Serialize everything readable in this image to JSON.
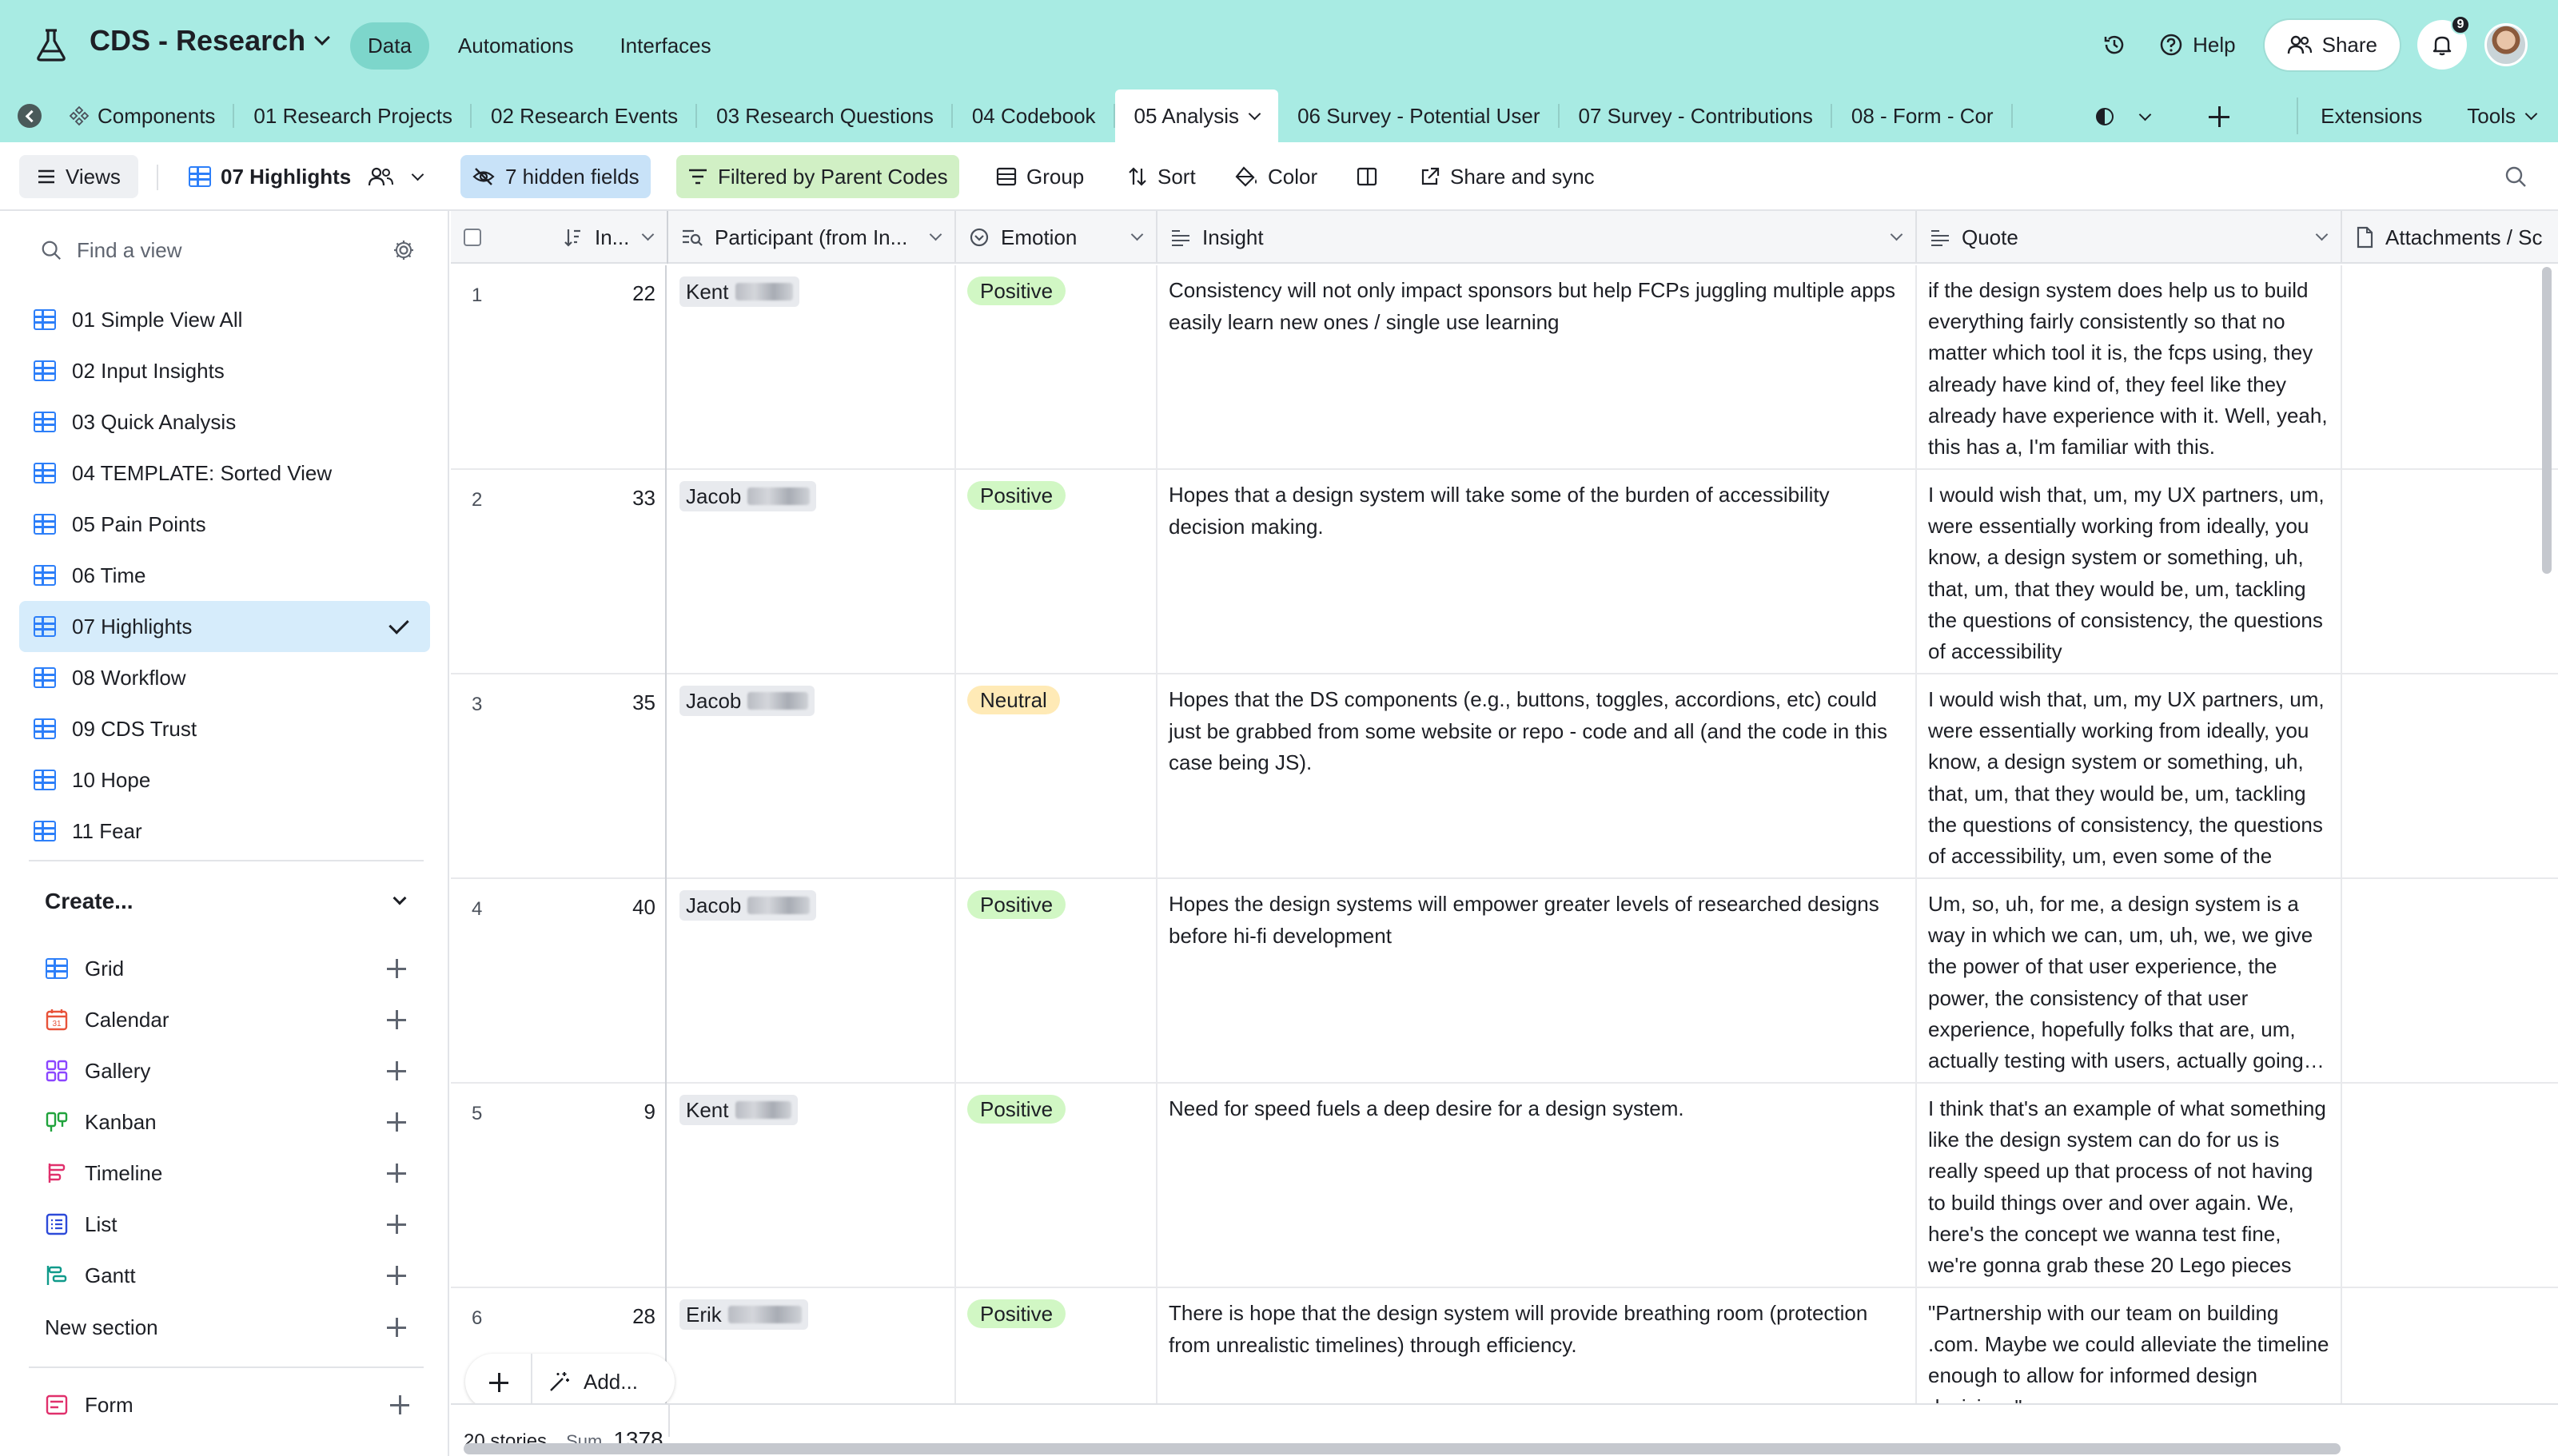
{
  "app": {
    "base_title": "CDS - Research",
    "nav": [
      "Data",
      "Automations",
      "Interfaces"
    ],
    "help_label": "Help",
    "share_label": "Share",
    "notification_count": "9",
    "accent_color": "#a8ebe3"
  },
  "tables": {
    "tabs": [
      "Components",
      "01 Research Projects",
      "02 Research Events",
      "03 Research Questions",
      "04 Codebook",
      "05 Analysis",
      "06 Survey - Potential User",
      "07 Survey - Contributions",
      "08 - Form - Cor"
    ],
    "active_tab": "05 Analysis",
    "extensions_label": "Extensions",
    "tools_label": "Tools"
  },
  "toolbar": {
    "views_label": "Views",
    "view_name": "07 Highlights",
    "hidden_fields": "7 hidden fields",
    "filter": "Filtered by Parent Codes",
    "group": "Group",
    "sort": "Sort",
    "color": "Color",
    "share_sync": "Share and sync"
  },
  "sidebar": {
    "find_placeholder": "Find a view",
    "views": [
      "01 Simple View All",
      "02 Input Insights",
      "03 Quick Analysis",
      "04 TEMPLATE: Sorted View",
      "05 Pain Points",
      "06 Time",
      "07 Highlights",
      "08 Workflow",
      "09 CDS Trust",
      "10 Hope",
      "11 Fear"
    ],
    "active_view": "07 Highlights",
    "create_label": "Create...",
    "create_items": [
      {
        "label": "Grid",
        "icon": "grid-icon"
      },
      {
        "label": "Calendar",
        "icon": "calendar-icon"
      },
      {
        "label": "Gallery",
        "icon": "gallery-icon"
      },
      {
        "label": "Kanban",
        "icon": "kanban-icon"
      },
      {
        "label": "Timeline",
        "icon": "timeline-icon"
      },
      {
        "label": "List",
        "icon": "list-icon"
      },
      {
        "label": "Gantt",
        "icon": "gantt-icon"
      }
    ],
    "new_section": "New section",
    "form_label": "Form"
  },
  "grid": {
    "columns": {
      "in": "In...",
      "participant": "Participant (from In...",
      "emotion": "Emotion",
      "insight": "Insight",
      "quote": "Quote",
      "attachments": "Attachments / Sc"
    },
    "rows": [
      {
        "n": "1",
        "in": "22",
        "participant": "Kent",
        "emotion": "Positive",
        "insight": "Consistency will not only impact sponsors but help FCPs juggling multiple apps easily learn new ones / single use learning",
        "quote": "if the design system does help us to build everything fairly consistently so that no matter which tool it is, the fcps using, they already have kind of, they feel like they already have experience with it. Well, yeah, this has a, I'm familiar with this."
      },
      {
        "n": "2",
        "in": "33",
        "participant": "Jacob",
        "emotion": "Positive",
        "insight": "Hopes that a design system will take some of the burden of accessibility decision making.",
        "quote": "I would wish that, um, my UX partners, um, were essentially working from ideally, you know, a design system or something, uh, that, um, that they would be, um, tackling the questions of consistency, the questions of accessibility"
      },
      {
        "n": "3",
        "in": "35",
        "participant": "Jacob",
        "emotion": "Neutral",
        "insight": "Hopes that the DS components (e.g., buttons, toggles, accordions, etc) could just be grabbed from some website or repo - code and all (and the code in this case being JS).",
        "quote": "I would wish that, um, my UX partners, um, were essentially working from ideally, you know, a design system or something, uh, that, um, that they would be, um, tackling the questions of consistency, the questions of accessibility, um, even some of the"
      },
      {
        "n": "4",
        "in": "40",
        "participant": "Jacob",
        "emotion": "Positive",
        "insight": "Hopes the design systems will empower greater levels of researched designs before hi-fi development",
        "quote": "Um, so, uh, for me, a design system is a way in which we can, um, uh, we, we give the power of that user experience, the power, the consistency of that user experience, hopefully folks that are, um, actually testing with users, actually going out"
      },
      {
        "n": "5",
        "in": "9",
        "participant": "Kent",
        "emotion": "Positive",
        "insight": "Need for speed fuels a deep desire for a design system.",
        "quote": "I think that's an example of what something like the design system can do for us is really speed up that process of not having to build things over and over again. We, here's the concept we wanna test fine, we're gonna grab these 20 Lego pieces"
      },
      {
        "n": "6",
        "in": "28",
        "participant": "Erik",
        "emotion": "Positive",
        "insight": "There is hope that the design system will provide breathing room (protection from unrealistic timelines) through efficiency.",
        "quote": "\"Partnership with our team on building .com.  Maybe we could alleviate the timeline enough to allow for informed design decisions\""
      }
    ],
    "footer": {
      "count": "20 stories",
      "sum_label": "Sum",
      "sum_value": "1378"
    },
    "add_label": "Add..."
  }
}
